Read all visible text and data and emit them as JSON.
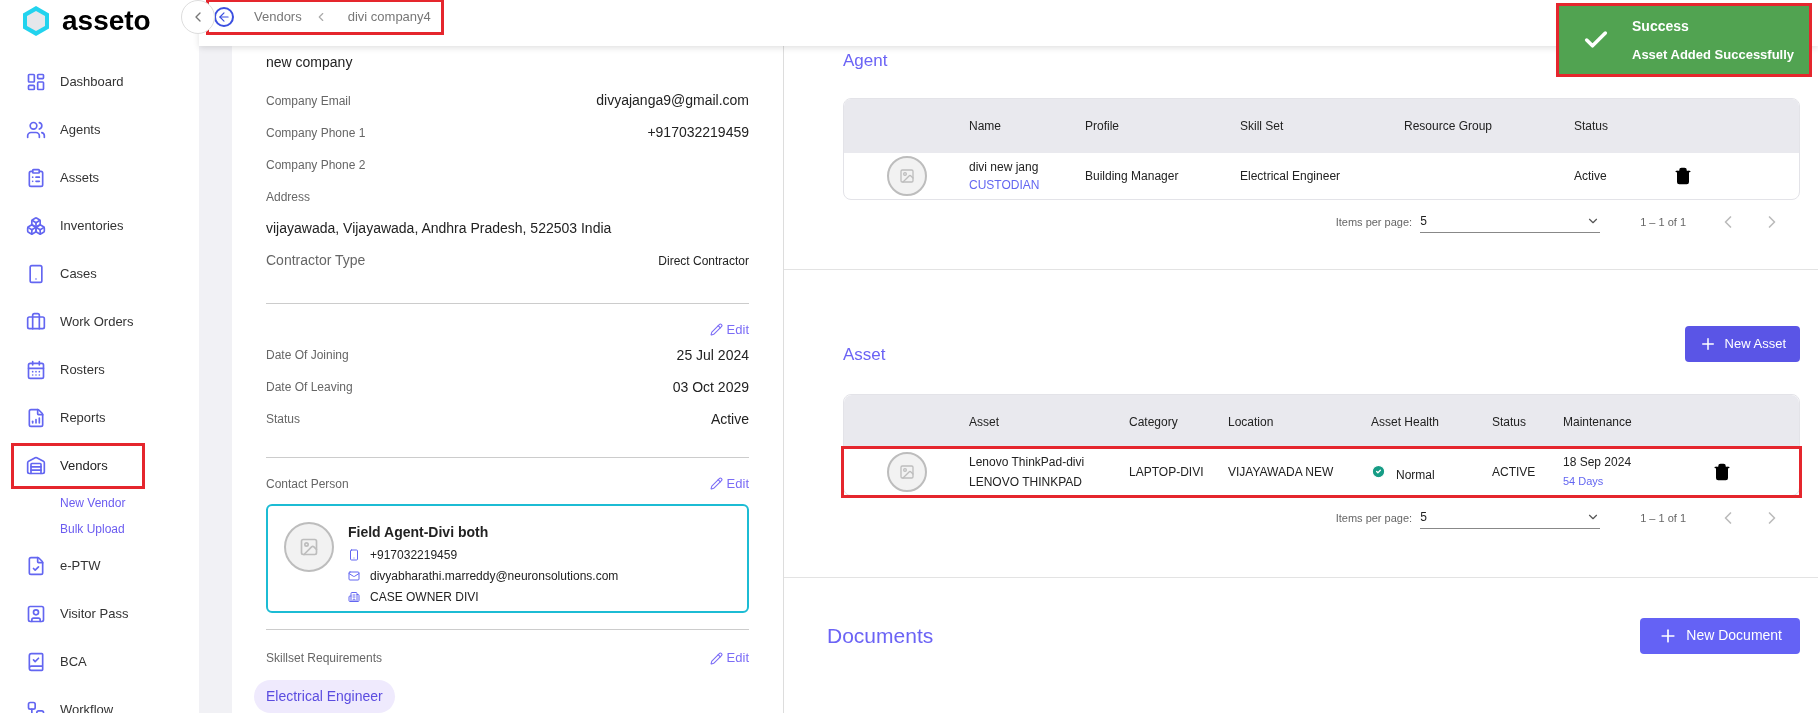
{
  "sidebar": {
    "logo": "asseto",
    "items": [
      {
        "label": "Dashboard",
        "selected": false,
        "highlighted": false
      },
      {
        "label": "Agents",
        "selected": false,
        "highlighted": false
      },
      {
        "label": "Assets",
        "selected": false,
        "highlighted": false
      },
      {
        "label": "Inventories",
        "selected": false,
        "highlighted": false
      },
      {
        "label": "Cases",
        "selected": false,
        "highlighted": false
      },
      {
        "label": "Work Orders",
        "selected": false,
        "highlighted": false
      },
      {
        "label": "Rosters",
        "selected": false,
        "highlighted": false
      },
      {
        "label": "Reports",
        "selected": false,
        "highlighted": false
      },
      {
        "label": "Vendors",
        "selected": true,
        "highlighted": true,
        "children": [
          {
            "label": "New Vendor"
          },
          {
            "label": "Bulk Upload"
          }
        ]
      },
      {
        "label": "e-PTW",
        "selected": false,
        "highlighted": false
      },
      {
        "label": "Visitor Pass",
        "selected": false,
        "highlighted": false
      },
      {
        "label": "BCA",
        "selected": false,
        "highlighted": false
      },
      {
        "label": "Workflow",
        "selected": false,
        "highlighted": false
      }
    ]
  },
  "breadcrumb": {
    "items": [
      "Vendors",
      "divi company4"
    ],
    "highlighted": true
  },
  "toast": {
    "title": "Success",
    "message": "Asset Added Successfully",
    "highlighted": true
  },
  "company": {
    "name": "new company",
    "rows": [
      {
        "kind": "pair",
        "label": "Company Email",
        "value": "divyajanga9@gmail.com"
      },
      {
        "kind": "pair",
        "label": "Company Phone 1",
        "value": "+917032219459"
      },
      {
        "kind": "pair",
        "label": "Company Phone 2"
      },
      {
        "kind": "pair",
        "label": "Address"
      },
      {
        "kind": "text",
        "value": "vijayawada, Vijayawada, Andhra Pradesh, 522503 India"
      },
      {
        "kind": "type",
        "label": "Contractor Type",
        "value": "Direct Contractor"
      }
    ]
  },
  "dates": {
    "edit": "Edit",
    "rows": [
      {
        "label": "Date Of Joining",
        "value": "25 Jul 2024"
      },
      {
        "label": "Date Of Leaving",
        "value": "03 Oct 2029"
      },
      {
        "label": "Status",
        "value": "Active"
      }
    ]
  },
  "contact": {
    "label": "Contact Person",
    "edit": "Edit",
    "name": "Field Agent-Divi both",
    "phone": "+917032219459",
    "email": "divyabharathi.marreddy@neuronsolutions.com",
    "role": "CASE OWNER DIVI"
  },
  "skills": {
    "label": "Skillset Requirements",
    "edit": "Edit",
    "tags": [
      "Electrical Engineer"
    ]
  },
  "agent": {
    "title": "Agent",
    "columns": [
      "Name",
      "Profile",
      "Skill Set",
      "Resource Group",
      "Status"
    ],
    "rows": [
      {
        "name": "divi new jang",
        "role": "CUSTODIAN",
        "profile": "Building Manager",
        "skill_set": "Electrical Engineer",
        "status": "Active"
      }
    ],
    "pagination": {
      "label": "Items per page:",
      "value": "5",
      "range": "1 – 1 of 1"
    }
  },
  "asset": {
    "title": "Asset",
    "button": "New Asset",
    "columns": [
      "Asset",
      "Category",
      "Location",
      "Asset Health",
      "Status",
      "Maintenance"
    ],
    "rows": [
      {
        "asset": "Lenovo ThinkPad-divi",
        "model": "LENOVO THINKPAD",
        "category": "LAPTOP-DIVI",
        "location": "VIJAYAWADA NEW",
        "health": "Normal",
        "status": "ACTIVE",
        "maintenance_date": "18 Sep 2024",
        "maintenance_days": "54 Days",
        "highlighted": true
      }
    ],
    "pagination": {
      "label": "Items per page:",
      "value": "5",
      "range": "1 – 1 of 1"
    }
  },
  "documents": {
    "title": "Documents",
    "button": "New Document"
  }
}
